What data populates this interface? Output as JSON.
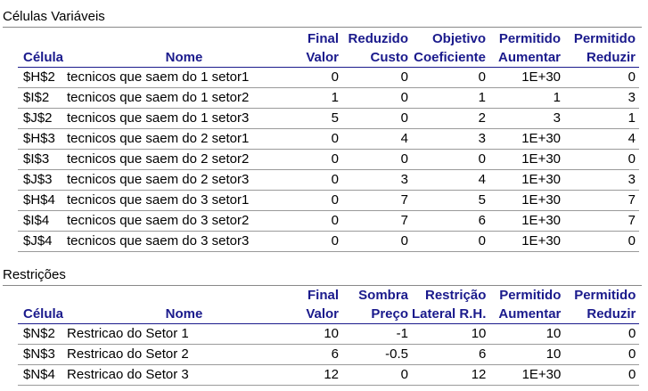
{
  "variable_cells": {
    "title": "Células Variáveis",
    "headers_top": [
      "",
      "",
      "Final",
      "Reduzido",
      "Objetivo",
      "Permitido",
      "Permitido"
    ],
    "headers_bottom": [
      "Célula",
      "Nome",
      "Valor",
      "Custo",
      "Coeficiente",
      "Aumentar",
      "Reduzir"
    ],
    "rows": [
      [
        "$H$2",
        "tecnicos que saem do 1 setor1",
        "0",
        "0",
        "0",
        "1E+30",
        "0"
      ],
      [
        "$I$2",
        "tecnicos que saem do 1 setor2",
        "1",
        "0",
        "1",
        "1",
        "3"
      ],
      [
        "$J$2",
        "tecnicos que saem do 1 setor3",
        "5",
        "0",
        "2",
        "3",
        "1"
      ],
      [
        "$H$3",
        "tecnicos que saem do 2 setor1",
        "0",
        "4",
        "3",
        "1E+30",
        "4"
      ],
      [
        "$I$3",
        "tecnicos que saem do 2 setor2",
        "0",
        "0",
        "0",
        "1E+30",
        "0"
      ],
      [
        "$J$3",
        "tecnicos que saem do 2 setor3",
        "0",
        "3",
        "4",
        "1E+30",
        "3"
      ],
      [
        "$H$4",
        "tecnicos que saem do 3 setor1",
        "0",
        "7",
        "5",
        "1E+30",
        "7"
      ],
      [
        "$I$4",
        "tecnicos que saem do 3 setor2",
        "0",
        "7",
        "6",
        "1E+30",
        "7"
      ],
      [
        "$J$4",
        "tecnicos que saem do 3 setor3",
        "0",
        "0",
        "0",
        "1E+30",
        "0"
      ]
    ]
  },
  "constraints": {
    "title": "Restrições",
    "headers_top": [
      "",
      "",
      "Final",
      "Sombra",
      "Restrição",
      "Permitido",
      "Permitido"
    ],
    "headers_bottom": [
      "Célula",
      "Nome",
      "Valor",
      "Preço",
      "Lateral R.H.",
      "Aumentar",
      "Reduzir"
    ],
    "rows": [
      [
        "$N$2",
        "Restricao do Setor 1",
        "10",
        "-1",
        "10",
        "10",
        "0"
      ],
      [
        "$N$3",
        "Restricao do Setor 2",
        "6",
        "-0.5",
        "6",
        "10",
        "0"
      ],
      [
        "$N$4",
        "Restricao do Setor 3",
        "12",
        "0",
        "12",
        "1E+30",
        "0"
      ]
    ]
  },
  "colors": {
    "header_text": "#1a1a8c",
    "row_rule": "#9a9a9a"
  }
}
